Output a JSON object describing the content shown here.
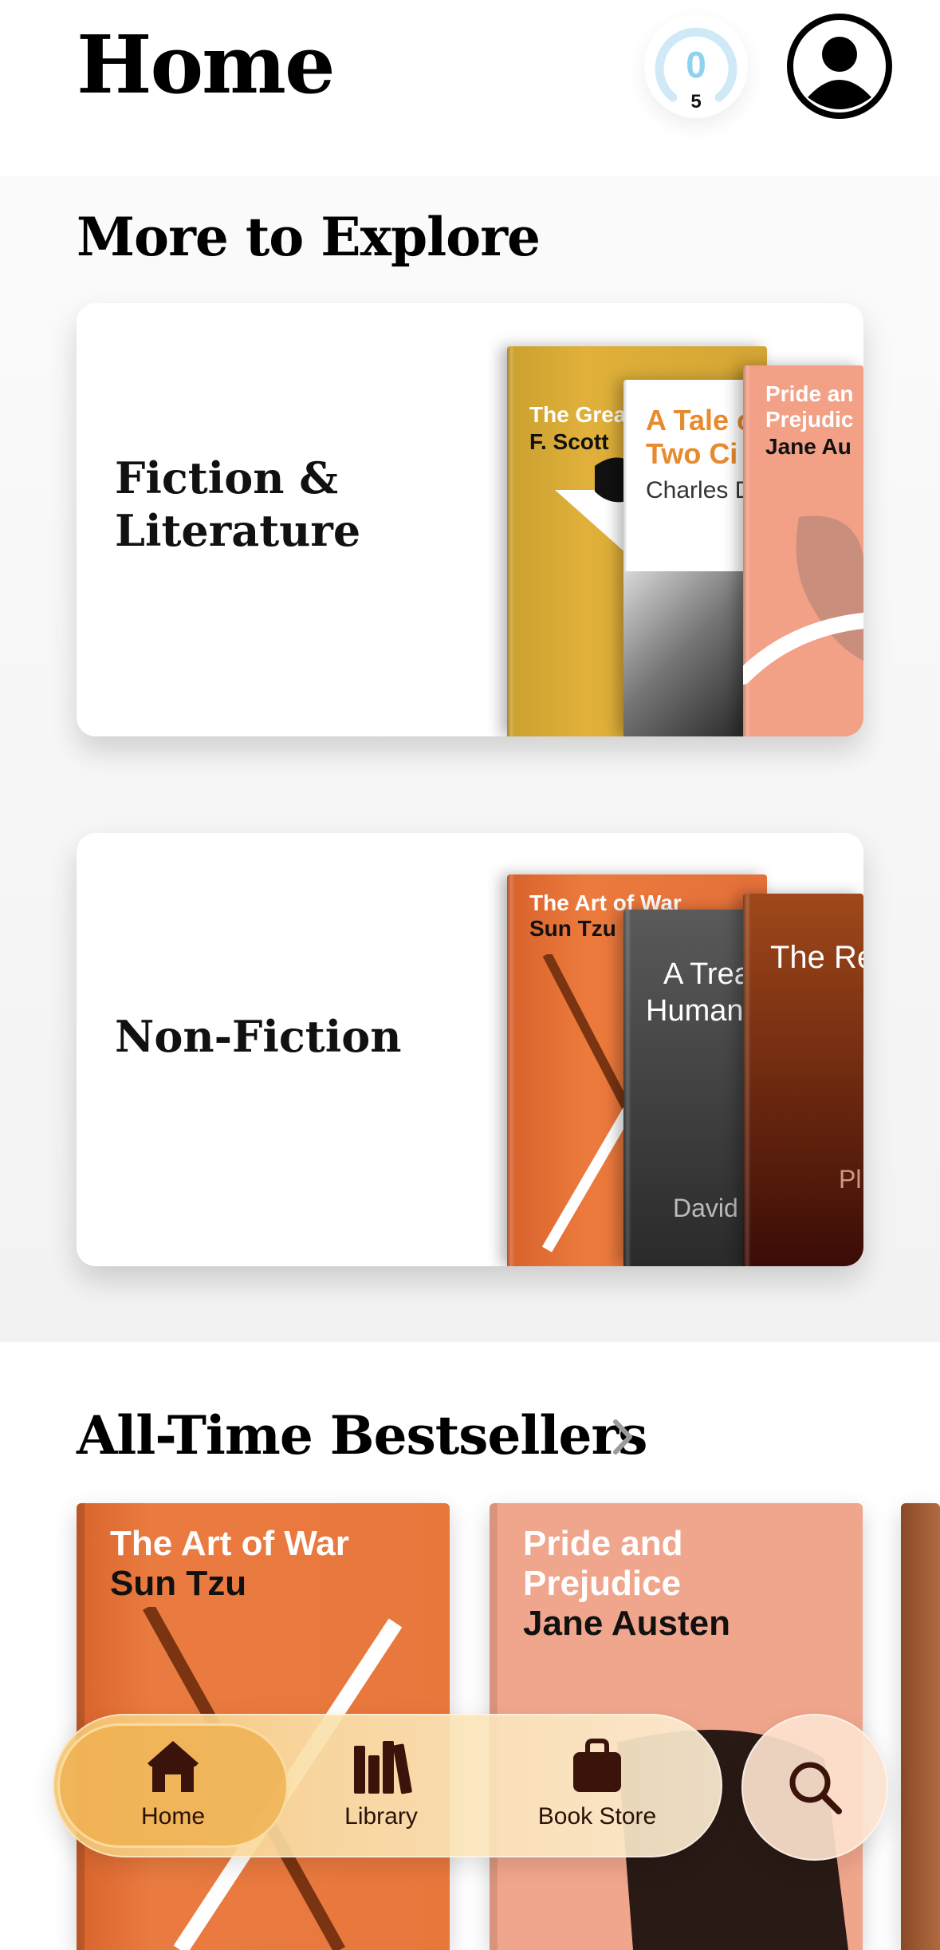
{
  "header": {
    "title": "Home",
    "reading_goal": {
      "value": "0",
      "target": "5",
      "progress": 0
    }
  },
  "explore": {
    "title": "More to Explore",
    "categories": [
      {
        "label": "Fiction & Literature",
        "books": [
          {
            "title": "The Great Gatsby",
            "author": "F. Scott",
            "color": "#d9a82f"
          },
          {
            "title": "A Tale of Two Cities",
            "title_line1": "A Tale o",
            "title_line2": "Two Ci",
            "author": "Charles D",
            "color": "#ffffff"
          },
          {
            "title": "Pride and Prejudice",
            "title_line1": "Pride an",
            "title_line2": "Prejudic",
            "author": "Jane Au",
            "color": "#f2a086"
          }
        ]
      },
      {
        "label": "Non-Fiction",
        "books": [
          {
            "title": "The Art of War",
            "author": "Sun Tzu",
            "color": "#e8733a"
          },
          {
            "title": "A Treatise of Human Nature",
            "title_line1": "A Trea",
            "title_line2": "Human",
            "author": "David",
            "color": "#4a4a4a"
          },
          {
            "title": "The Republic",
            "title_line1": "The Re",
            "author": "Pl",
            "color": "#8a3a14"
          }
        ]
      }
    ]
  },
  "bestsellers": {
    "title": "All-Time Bestsellers",
    "books": [
      {
        "title": "The Art of War",
        "author": "Sun Tzu",
        "color": "#e8773c"
      },
      {
        "title_line1": "Pride and",
        "title_line2": "Prejudice",
        "author": "Jane Austen",
        "color": "#f0a68c"
      }
    ]
  },
  "tab_bar": {
    "tabs": [
      {
        "label": "Home",
        "icon": "house-icon",
        "selected": true
      },
      {
        "label": "Library",
        "icon": "books-icon",
        "selected": false
      },
      {
        "label": "Book Store",
        "icon": "shopping-bag-icon",
        "selected": false
      }
    ],
    "search_icon": "magnifier-icon"
  },
  "colors": {
    "accent": "#eeb252",
    "goal_ring": "#8fd2ee"
  }
}
